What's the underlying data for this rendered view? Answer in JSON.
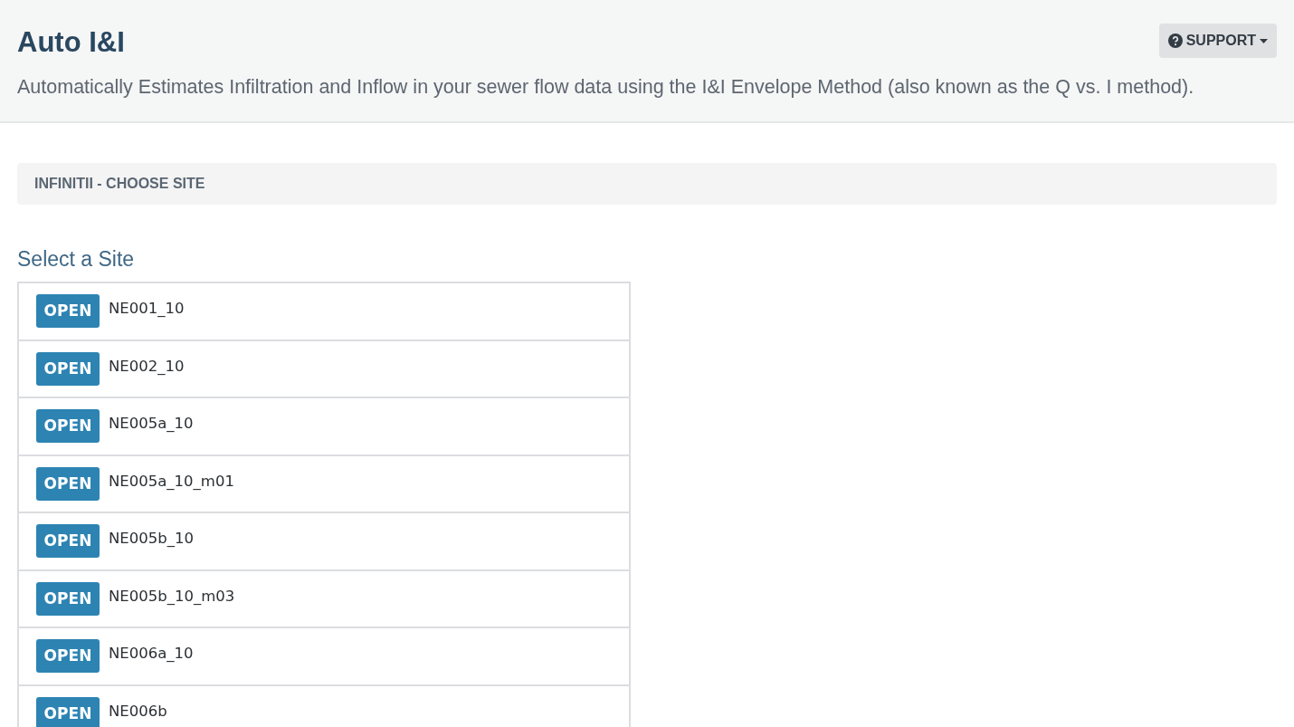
{
  "header": {
    "title": "Auto I&I",
    "subtitle": "Automatically Estimates Infiltration and Inflow in your sewer flow data using the I&I Envelope Method (also known as the Q vs. I method).",
    "support_button": "SUPPORT"
  },
  "breadcrumb": "INFINITII - CHOOSE SITE",
  "section_title": "Select a Site",
  "sites": [
    {
      "button": "OPEN",
      "name": "NE001_10"
    },
    {
      "button": "OPEN",
      "name": "NE002_10"
    },
    {
      "button": "OPEN",
      "name": "NE005a_10"
    },
    {
      "button": "OPEN",
      "name": "NE005a_10_m01"
    },
    {
      "button": "OPEN",
      "name": "NE005b_10"
    },
    {
      "button": "OPEN",
      "name": "NE005b_10_m03"
    },
    {
      "button": "OPEN",
      "name": "NE006a_10"
    },
    {
      "button": "OPEN",
      "name": "NE006b"
    }
  ]
}
